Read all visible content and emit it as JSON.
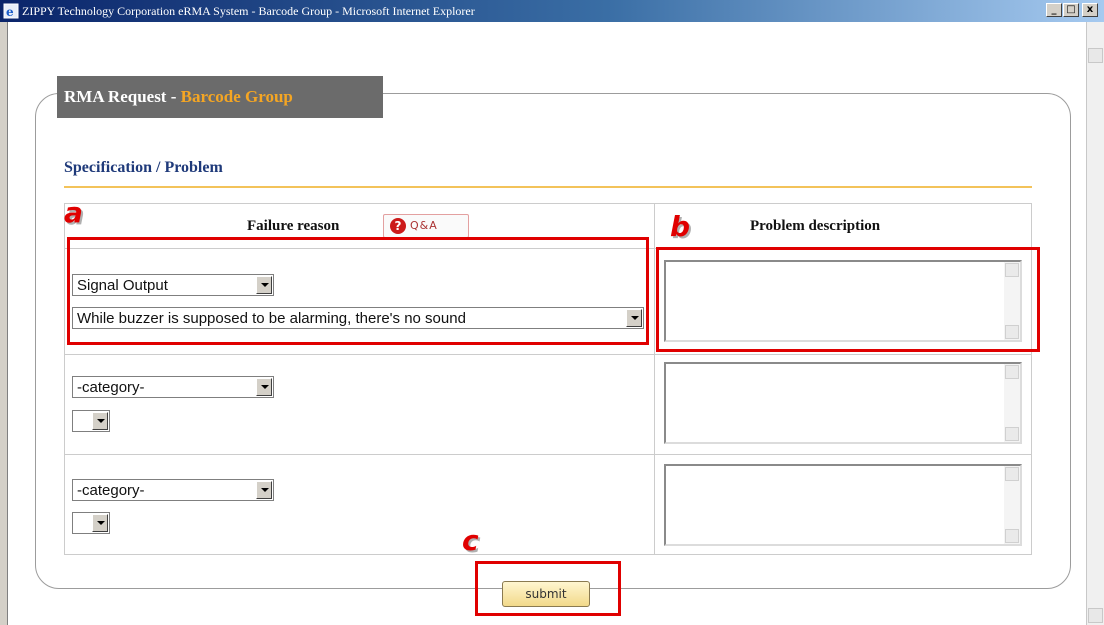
{
  "window": {
    "title": "ZIPPY Technology Corporation eRMA System - Barcode Group - Microsoft Internet Explorer",
    "buttons": [
      "_",
      "□",
      "x"
    ]
  },
  "panel": {
    "legend_prefix": "RMA Request - ",
    "legend_accent": "Barcode Group",
    "section_title": "Specification / Problem"
  },
  "table": {
    "failure_header": "Failure reason",
    "problem_header": "Problem description",
    "qa_label": "Q&A",
    "qa_icon": "?",
    "rows": [
      {
        "category": "Signal Output",
        "detail": "While buzzer is supposed to be alarming, there's no sound",
        "description": ""
      },
      {
        "category": "-category-",
        "detail": "",
        "description": ""
      },
      {
        "category": "-category-",
        "detail": "",
        "description": ""
      }
    ]
  },
  "actions": {
    "submit_label": "submit"
  },
  "annotations": {
    "a": "a",
    "b": "b",
    "c": "c",
    "color": "#e00000"
  },
  "colors": {
    "accent": "#f5a623",
    "section_title": "#1f3a7a",
    "rule": "#f3c35a",
    "legend_bg": "#6b6b6b"
  }
}
